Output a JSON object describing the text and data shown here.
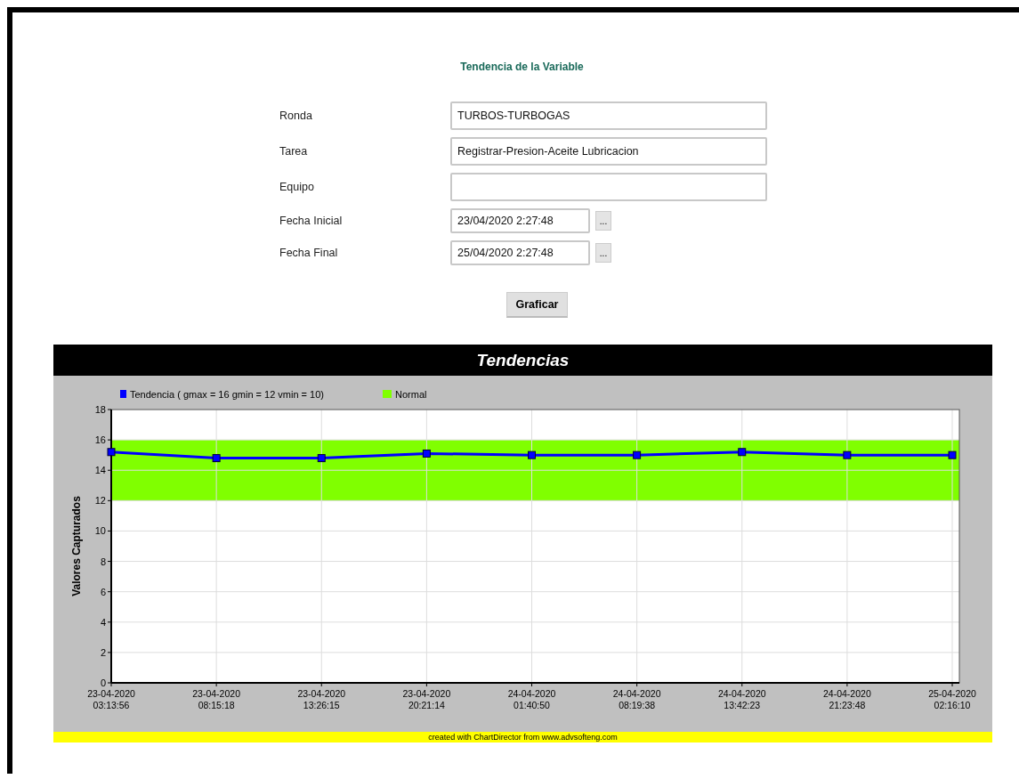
{
  "form": {
    "title": "Tendencia de la Variable",
    "fields": [
      {
        "label": "Ronda",
        "value": "TURBOS-TURBOGAS",
        "kind": "text"
      },
      {
        "label": "Tarea",
        "value": "Registrar-Presion-Aceite Lubricacion",
        "kind": "text"
      },
      {
        "label": "Equipo",
        "kind": "text"
      },
      {
        "label": "Fecha Inicial",
        "value": "23/04/2020 2:27:48",
        "kind": "date",
        "picker": "..."
      },
      {
        "label": "Fecha Final",
        "value": "25/04/2020 2:27:48",
        "kind": "date",
        "picker": "..."
      }
    ],
    "button": "Graficar"
  },
  "chart": {
    "header": "Tendencias",
    "footer": "created with ChartDirector from www.advsofteng.com",
    "chart_data": {
      "type": "line",
      "ylabel": "Valores Capturados",
      "categories": [
        "23-04-2020 03:13:56",
        "23-04-2020 08:15:18",
        "23-04-2020 13:26:15",
        "23-04-2020 20:21:14",
        "24-04-2020 01:40:50",
        "24-04-2020 08:19:38",
        "24-04-2020 13:42:23",
        "24-04-2020 21:23:48",
        "25-04-2020 02:16:10"
      ],
      "series": [
        {
          "name": "Tendencia ( gmax = 16 gmin = 12 vmin = 10)",
          "color": "#0000ff",
          "marker": "square",
          "values": [
            15.2,
            14.8,
            14.8,
            15.1,
            15.0,
            15.0,
            15.2,
            15.0,
            15.0
          ]
        }
      ],
      "ylim": [
        0,
        18
      ],
      "yticks": [
        0,
        2,
        4,
        6,
        8,
        10,
        12,
        14,
        16,
        18
      ],
      "grid": true,
      "legend": "top",
      "bands": [
        {
          "axis": "y",
          "label": "Normal",
          "color": "#80ff00",
          "from": 12,
          "to": 16
        }
      ]
    }
  }
}
